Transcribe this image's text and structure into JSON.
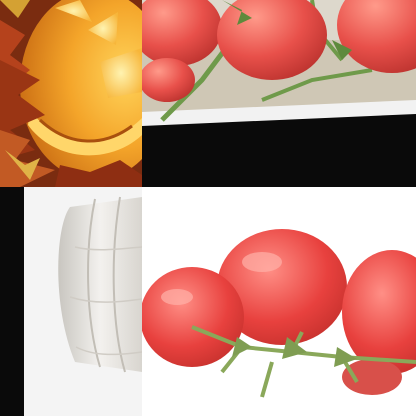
{
  "collage": {
    "tiles": [
      {
        "id": "top-left",
        "subject": "jack-o-lantern"
      },
      {
        "id": "top-right",
        "subject": "tomatoes-on-vine"
      },
      {
        "id": "bottom-left",
        "subject": "white-pumpkin"
      },
      {
        "id": "bottom-right",
        "subject": "tomatoes-on-white"
      }
    ]
  },
  "colors": {
    "pumpkin_orange": "#f4a52a",
    "leaf_rust": "#b5421c",
    "tomato_red": "#e8413e",
    "tomato_highlight": "#ff8f86",
    "vine_green": "#6f9a4a",
    "black_band": "#0a0a0a",
    "white_pumpkin": "#e9e7e3"
  }
}
